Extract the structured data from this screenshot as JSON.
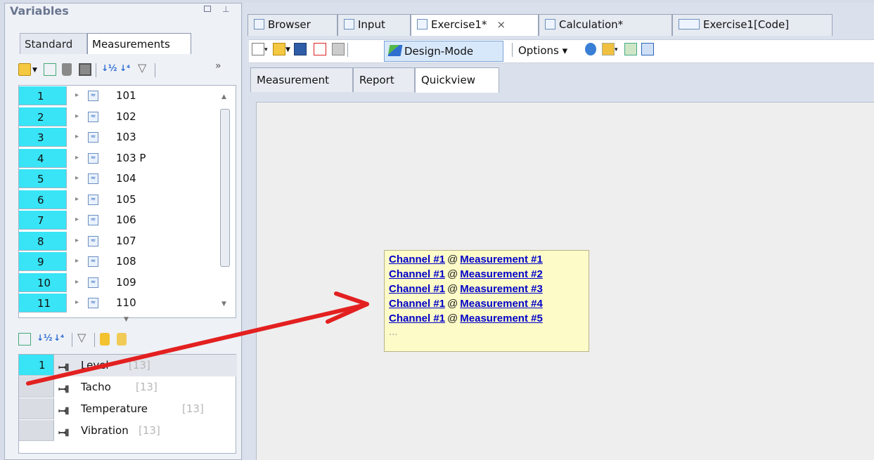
{
  "left_panel": {
    "title": "Variables",
    "tabs": [
      "Standard",
      "Measurements"
    ],
    "toolbar_more": "»",
    "tree_rows": [
      {
        "num": "1",
        "label": "101"
      },
      {
        "num": "2",
        "label": "102"
      },
      {
        "num": "3",
        "label": "103"
      },
      {
        "num": "4",
        "label": "103 P"
      },
      {
        "num": "5",
        "label": "104"
      },
      {
        "num": "6",
        "label": "105"
      },
      {
        "num": "7",
        "label": "106"
      },
      {
        "num": "8",
        "label": "107"
      },
      {
        "num": "9",
        "label": "108"
      },
      {
        "num": "10",
        "label": "109"
      },
      {
        "num": "11",
        "label": "110"
      }
    ],
    "channels": [
      {
        "num": "1",
        "label": "Level",
        "count": "[13]"
      },
      {
        "num": "",
        "label": "Tacho",
        "count": "[13]"
      },
      {
        "num": "",
        "label": "Temperature",
        "count": "[13]"
      },
      {
        "num": "",
        "label": "Vibration",
        "count": "[13]"
      }
    ]
  },
  "doc_tabs": {
    "browser": "Browser",
    "input": "Input",
    "exercise": "Exercise1*",
    "exercise_close": "×",
    "calculation": "Calculation*",
    "code": "Exercise1[Code]"
  },
  "toolbar": {
    "design_mode": "Design-Mode",
    "options": "Options ▾"
  },
  "sub_tabs": {
    "measurement": "Measurement",
    "report": "Report",
    "quickview": "Quickview"
  },
  "quickview": {
    "lines": [
      {
        "channel": "Channel #1",
        "at": "@",
        "measurement": "Measurement #1"
      },
      {
        "channel": "Channel #1",
        "at": "@",
        "measurement": "Measurement #2"
      },
      {
        "channel": "Channel #1",
        "at": "@",
        "measurement": "Measurement #3"
      },
      {
        "channel": "Channel #1",
        "at": "@",
        "measurement": "Measurement #4"
      },
      {
        "channel": "Channel #1",
        "at": "@",
        "measurement": "Measurement #5"
      }
    ],
    "more": "..."
  },
  "colors": {
    "row_highlight": "#38e4f5",
    "quickview_bg": "#fdfbc8",
    "link": "#0000c8",
    "arrow": "#e32020"
  }
}
